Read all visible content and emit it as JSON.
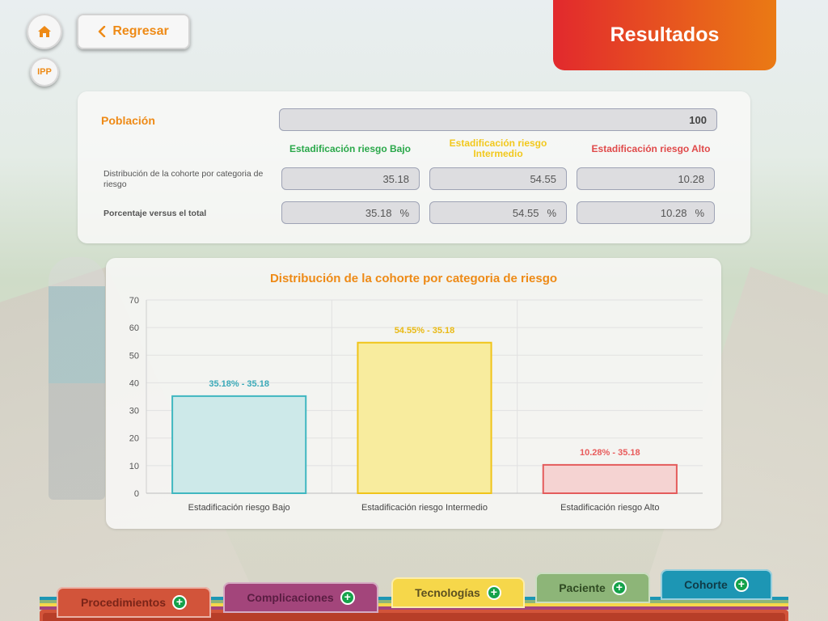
{
  "nav": {
    "back_label": "Regresar",
    "ipp_label": "IPP",
    "home_icon": "home-icon",
    "back_icon": "chevron-left-icon"
  },
  "header": {
    "title": "Resultados"
  },
  "results": {
    "population_label": "Población",
    "population_value": "100",
    "categories": [
      {
        "label": "Estadificación riesgo Bajo",
        "color": "#2aa84a"
      },
      {
        "label": "Estadificación riesgo Intermedio",
        "color": "#f2c81d"
      },
      {
        "label": "Estadificación riesgo Alto",
        "color": "#e04a4a"
      }
    ],
    "row1_label": "Distribución de la cohorte por categoria de riesgo",
    "row1_values": [
      "35.18",
      "54.55",
      "10.28"
    ],
    "row2_label": "Porcentaje versus el total",
    "row2_values": [
      "35.18",
      "54.55",
      "10.28"
    ],
    "percent_symbol": "%"
  },
  "chart_data": {
    "type": "bar",
    "title": "Distribución de la cohorte por categoria de riesgo",
    "categories": [
      "Estadificación riesgo Bajo",
      "Estadificación riesgo Intermedio",
      "Estadificación riesgo Alto"
    ],
    "values": [
      35.18,
      54.55,
      10.28
    ],
    "data_labels": [
      "35.18% - 35.18",
      "54.55% - 35.18",
      "10.28% - 35.18"
    ],
    "colors": [
      "#5bc0c8",
      "#f2c81d",
      "#ea6a6a"
    ],
    "ylim": [
      0,
      70
    ],
    "yticks": [
      0,
      10,
      20,
      30,
      40,
      50,
      60,
      70
    ],
    "grid": true
  },
  "tabs": [
    {
      "label": "Procedimientos",
      "color": "#d2543a",
      "text_color": "#7a2418"
    },
    {
      "label": "Complicaciones",
      "color": "#a3457b",
      "text_color": "#5a1d42"
    },
    {
      "label": "Tecnologías",
      "color": "#f6d74a",
      "text_color": "#5c5020"
    },
    {
      "label": "Paciente",
      "color": "#8db578",
      "text_color": "#2f4a22"
    },
    {
      "label": "Cohorte",
      "color": "#1d96b4",
      "text_color": "#0f3c48"
    }
  ]
}
